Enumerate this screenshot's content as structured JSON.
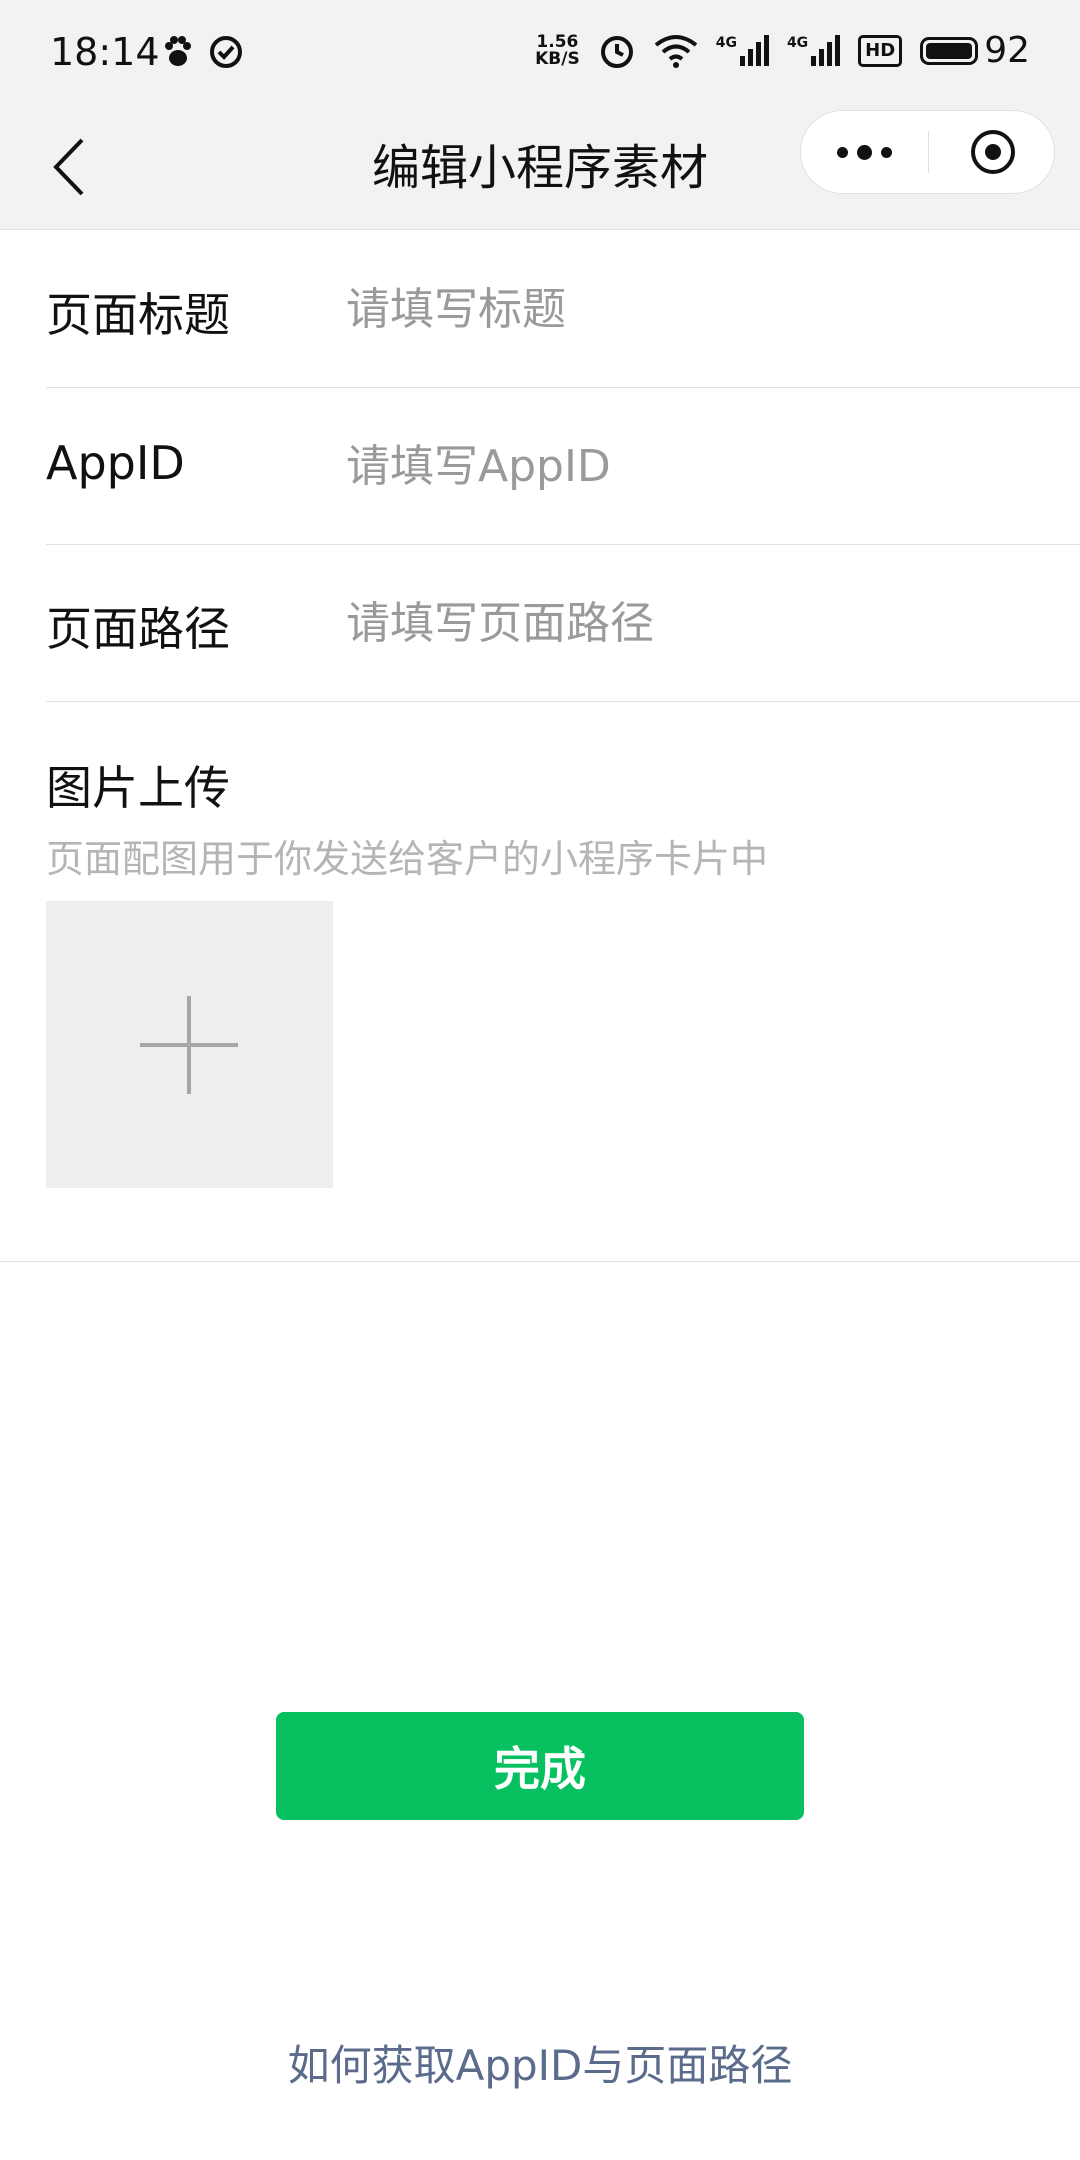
{
  "status_bar": {
    "time": "18:14",
    "net_speed_value": "1.56",
    "net_speed_unit": "KB/S",
    "signal_1": "4G",
    "signal_2": "4G",
    "hd_label": "HD",
    "battery": "92"
  },
  "nav": {
    "title": "编辑小程序素材"
  },
  "form": {
    "page_title": {
      "label": "页面标题",
      "value": "",
      "placeholder": "请填写标题"
    },
    "appid": {
      "label": "AppID",
      "value": "",
      "placeholder": "请填写AppID"
    },
    "page_path": {
      "label": "页面路径",
      "value": "",
      "placeholder": "请填写页面路径"
    }
  },
  "upload": {
    "title": "图片上传",
    "hint": "页面配图用于你发送给客户的小程序卡片中"
  },
  "actions": {
    "done_label": "完成",
    "help_link": "如何获取AppID与页面路径"
  },
  "colors": {
    "primary": "#07c160",
    "link": "#5b6b8c",
    "nav_bg": "#f2f2f2"
  },
  "icons": [
    "paw-icon",
    "check-circle-icon",
    "alarm-icon",
    "wifi-icon",
    "signal-icon",
    "hd-icon",
    "battery-icon",
    "back-icon",
    "more-icon",
    "close-target-icon",
    "plus-icon"
  ]
}
